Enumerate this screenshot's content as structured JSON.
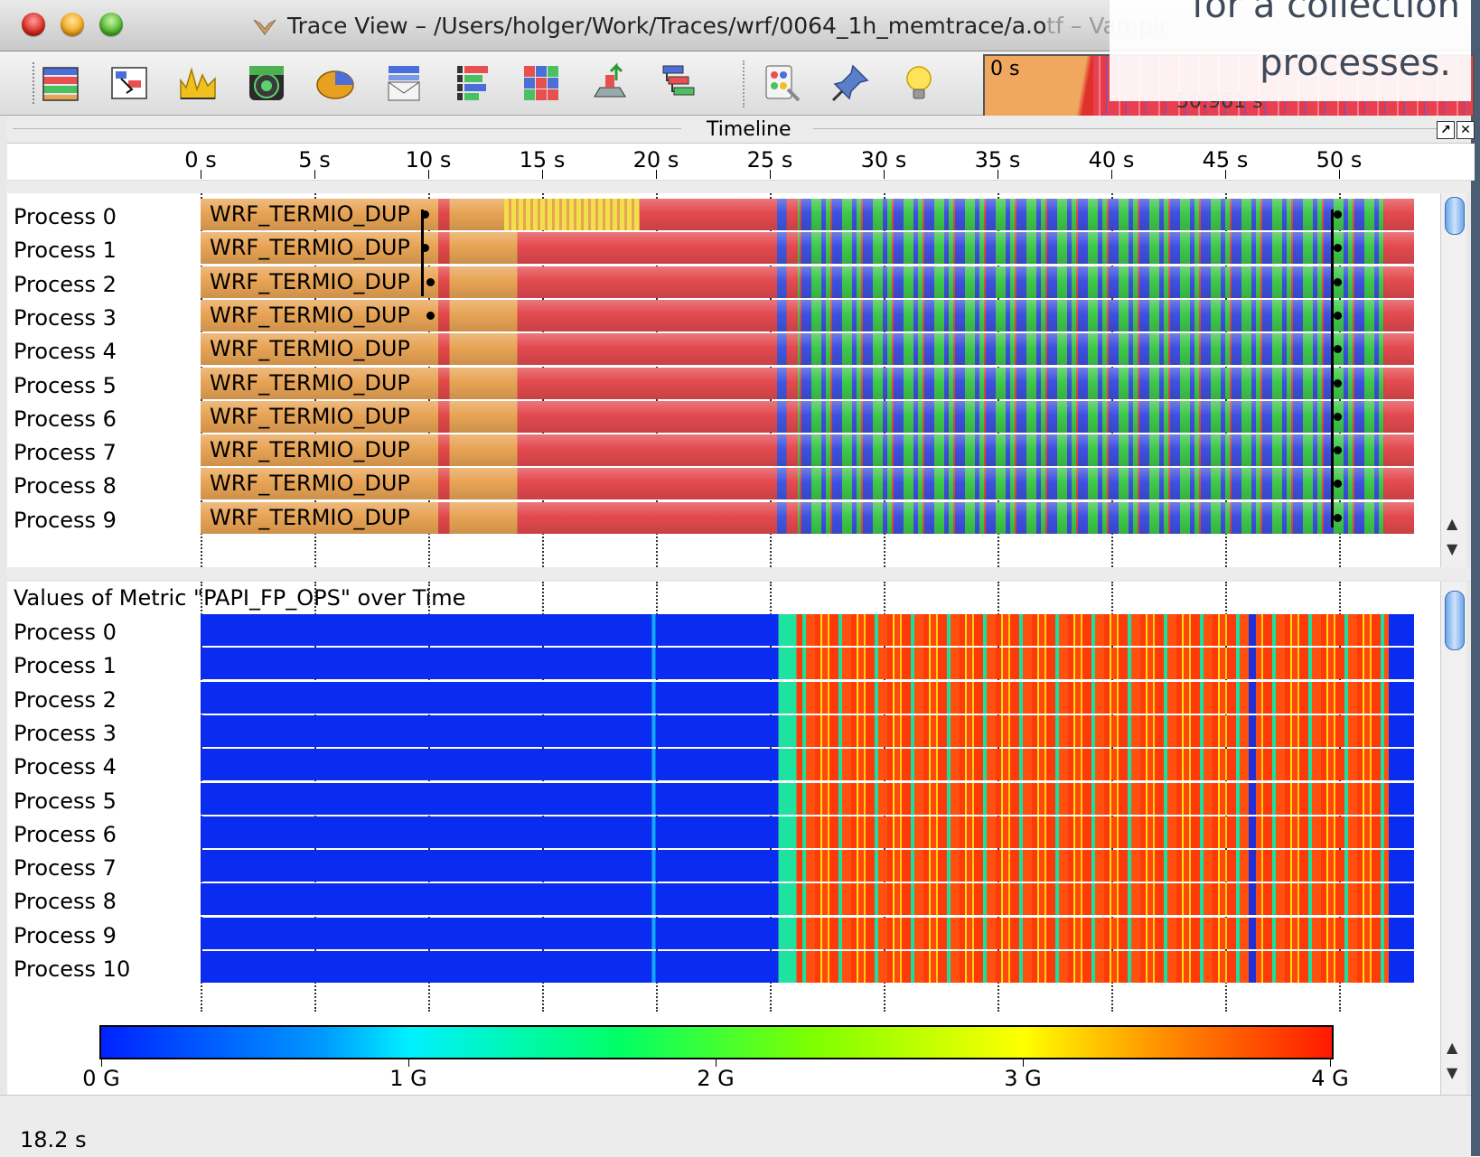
{
  "window": {
    "title": "Trace View – /Users/holger/Work/Traces/wrf/0064_1h_memtrace/a.o",
    "title_suffix": "tf – Vampir"
  },
  "caption": {
    "line1": "for a collection",
    "line2": "processes."
  },
  "toolbar": {
    "icons": [
      "master-timeline-icon",
      "process-timeline-icon",
      "counter-timeline-icon",
      "performance-radar-icon",
      "function-summary-icon",
      "message-summary-icon",
      "process-summary-icon",
      "communication-matrix-icon",
      "io-summary-icon",
      "call-tree-icon",
      "function-legend-icon",
      "marker-pin-icon",
      "lightbulb-icon"
    ],
    "overview_start": "0 s",
    "overview_end": "50.961 s"
  },
  "timeline": {
    "title": "Timeline",
    "ticks": [
      "0 s",
      "5 s",
      "10 s",
      "15 s",
      "20 s",
      "25 s",
      "30 s",
      "35 s",
      "40 s",
      "45 s",
      "50 s"
    ]
  },
  "master": {
    "processes": [
      "Process 0",
      "Process 1",
      "Process 2",
      "Process 3",
      "Process 4",
      "Process 5",
      "Process 6",
      "Process 7",
      "Process 8",
      "Process 9"
    ],
    "function_label": "WRF_TERMIO_DUP",
    "colors": {
      "io": "#e8a455",
      "mpi": "#e34a4f",
      "compute_a": "#3ec94a",
      "compute_b": "#3e50e0",
      "highlight": "#f2e04a"
    }
  },
  "counter": {
    "title": "Values of Metric \"PAPI_FP_OPS\" over Time",
    "processes": [
      "Process 0",
      "Process 1",
      "Process 2",
      "Process 3",
      "Process 4",
      "Process 5",
      "Process 6",
      "Process 7",
      "Process 8",
      "Process 9",
      "Process 10"
    ],
    "legend_labels": [
      "0 G",
      "1 G",
      "2 G",
      "3 G",
      "4 G"
    ],
    "legend_values": [
      0,
      1,
      2,
      3,
      4
    ],
    "colors": {
      "low": "#0022ff",
      "high": "#ff1a00"
    }
  },
  "status": {
    "time": "18.2 s"
  }
}
